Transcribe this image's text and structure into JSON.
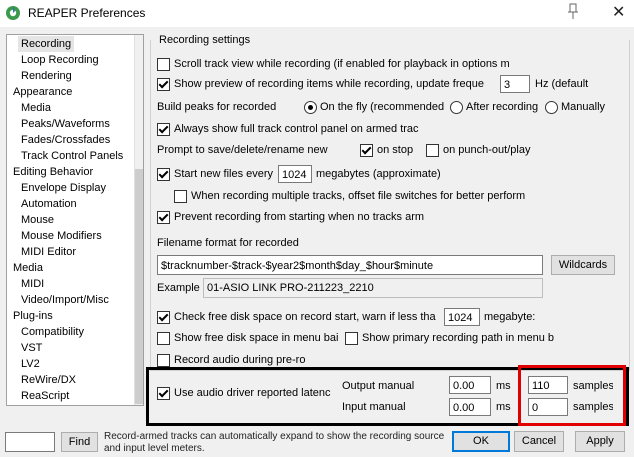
{
  "window": {
    "title": "REAPER Preferences"
  },
  "sidebar": {
    "items": [
      "Recording",
      "Loop Recording",
      "Rendering",
      "Appearance",
      "Media",
      "Peaks/Waveforms",
      "Fades/Crossfades",
      "Track Control Panels",
      "Editing Behavior",
      "Envelope Display",
      "Automation",
      "Mouse",
      "Mouse Modifiers",
      "MIDI Editor",
      "Media",
      "MIDI",
      "Video/Import/Misc",
      "Plug-ins",
      "Compatibility",
      "VST",
      "LV2",
      "ReWire/DX",
      "ReaScript"
    ]
  },
  "settings": {
    "group_title": "Recording settings",
    "scroll_track": "Scroll track view while recording (if enabled for playback in options m",
    "show_preview": "Show preview of recording items while recording, update freque",
    "preview_rate": "3",
    "preview_unit": "Hz (default",
    "build_peaks": "Build peaks for recorded",
    "peaks_fly": "On the fly (recommended",
    "peaks_after": "After recording",
    "peaks_manual": "Manually",
    "always_show_tcp": "Always show full track control panel on armed trac",
    "prompt": "Prompt to save/delete/rename new",
    "on_stop": "on stop",
    "on_punch": "on punch-out/play",
    "start_new_files": "Start new files every",
    "file_size": "1024",
    "file_size_unit": "megabytes (approximate)",
    "multi_track": "When recording multiple tracks, offset file switches for better perform",
    "prevent_no_arm": "Prevent recording from starting when no tracks arm",
    "filename_label": "Filename format for recorded",
    "filename_value": "$tracknumber-$track-$year2$month$day_$hour$minute",
    "wildcards": "Wildcards",
    "example_label": "Example",
    "example_value": "01-ASIO LINK PRO-211223_2210",
    "check_disk": "Check free disk space on record start, warn if less tha",
    "disk_mb": "1024",
    "disk_unit": "megabyte:",
    "show_disk_menu": "Show free disk space in menu bai",
    "show_path_menu": "Show primary recording path in menu b",
    "record_preroll": "Record audio during pre-ro",
    "use_driver_latency": "Use audio driver reported latenc",
    "output_manual": "Output manual",
    "input_manual": "Input manual",
    "out_ms": "0.00",
    "in_ms": "0.00",
    "ms": "ms",
    "out_samples": "110",
    "in_samples": "0",
    "samples": "samples"
  },
  "footer": {
    "find_placeholder": "",
    "find": "Find",
    "hint": "Record-armed tracks can automatically expand to show the recording source and input level meters.",
    "ok": "OK",
    "cancel": "Cancel",
    "apply": "Apply"
  }
}
